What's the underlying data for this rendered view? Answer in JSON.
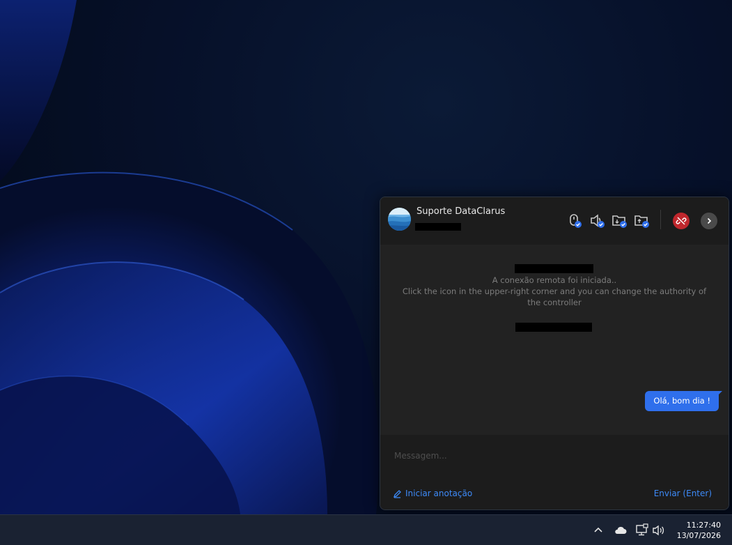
{
  "chat": {
    "contact_name": "Suporte DataClarus",
    "system_message_line1": "A conexão remota foi iniciada..",
    "system_message_line2": "Click the icon in the upper-right corner and you can change the authority of the controller",
    "user_message": "Olá, bom dia !",
    "input_placeholder": "Messagem...",
    "annotate_label": "Iniciar anotação",
    "send_label": "Enviar (Enter)"
  },
  "header_icons": [
    "mouse-permission-icon",
    "audio-permission-icon",
    "file-download-permission-icon",
    "file-upload-permission-icon",
    "disconnect-icon",
    "chevron-right-icon"
  ],
  "taskbar": {
    "time": "11:27:40",
    "date": "13/07/2026"
  },
  "colors": {
    "accent": "#2f6fec",
    "link": "#3d8af7",
    "disconnect": "#c0272d"
  }
}
